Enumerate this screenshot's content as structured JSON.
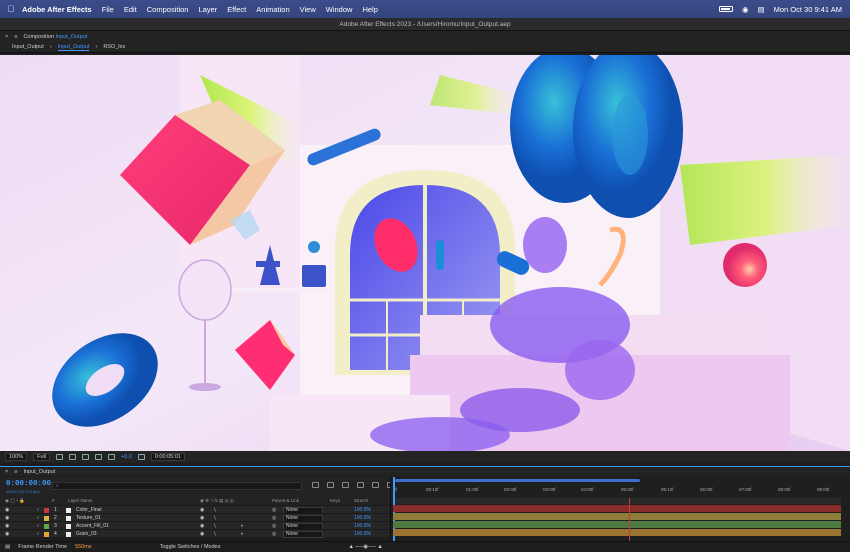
{
  "menubar": {
    "app_name": "Adobe After Effects",
    "items": [
      "File",
      "Edit",
      "Composition",
      "Layer",
      "Effect",
      "Animation",
      "View",
      "Window",
      "Help"
    ],
    "datetime": "Mon Oct 30  9:41 AM"
  },
  "window_title": "Adobe After Effects 2023 - /Users/Hiromu/Input_Output.aep",
  "composition_panel": {
    "label": "Composition",
    "comp_name": "Input_Output",
    "tabs": [
      "Input_Output",
      "Input_Output",
      "RSO_lex"
    ],
    "selected_tab": 1
  },
  "viewer_bar": {
    "zoom": "100%",
    "resolution": "Full",
    "exposure": "+0.0",
    "time": "0:00:05:01"
  },
  "timeline": {
    "comp_tab": "Input_Output",
    "timecode": "0:00:00:00",
    "fps": "00000 (23.976 fps)",
    "search_placeholder": "⌕",
    "columns": {
      "layer_name": "Layer Name",
      "parent": "Parent & Link",
      "keys": "Keys",
      "stretch": "Stretch",
      "num": "#"
    },
    "ruler_ticks": [
      "0f",
      "00:12f",
      "01:00f",
      "02:00f",
      "03:00f",
      "04:00f",
      "05:00f",
      "05:12f",
      "06:00f",
      "07:00f",
      "08:00f",
      "09:00f"
    ],
    "layers": [
      {
        "num": "1",
        "name": "Color_Final",
        "color": "#c73a3a",
        "parent": "None",
        "stretch": "100.0%"
      },
      {
        "num": "2",
        "name": "Texture_01",
        "color": "#d6b74a",
        "parent": "None",
        "stretch": "100.0%"
      },
      {
        "num": "3",
        "name": "Accent_Fill_01",
        "color": "#5fa84e",
        "parent": "None",
        "stretch": "100.0%"
      },
      {
        "num": "4",
        "name": "Grain_03",
        "color": "#e0a23a",
        "parent": "None",
        "stretch": "100.0%"
      }
    ]
  },
  "footer": {
    "render_label": "Frame Render Time",
    "render_time": "550ms",
    "toggle": "Toggle Switches / Modes"
  },
  "colors": {
    "accent": "#3d9bff",
    "menubar": "#3b4c8a",
    "panel": "#232323"
  }
}
